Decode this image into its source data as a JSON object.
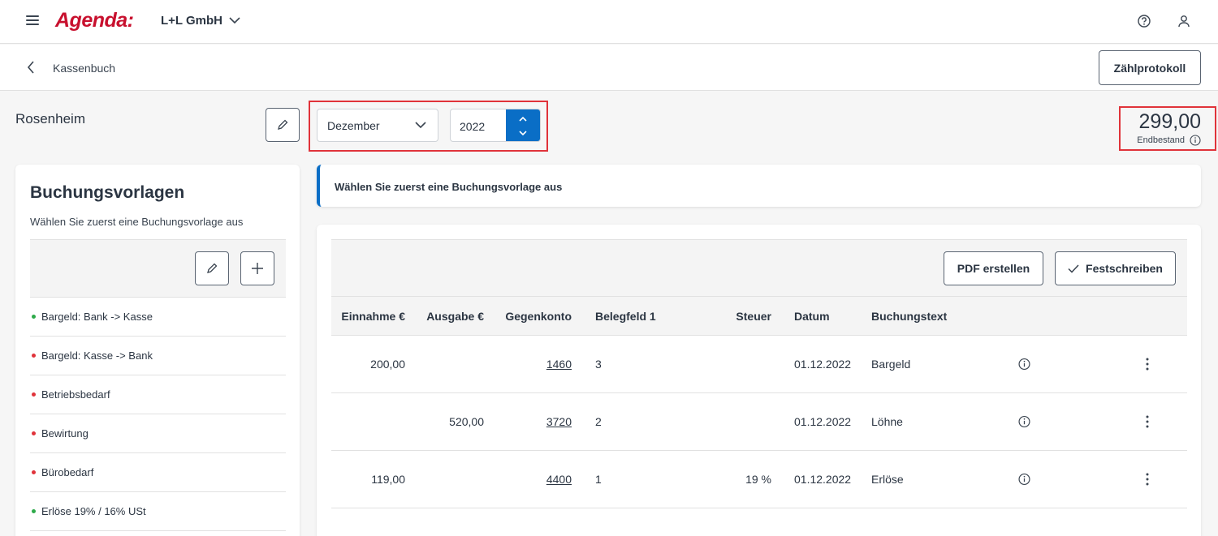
{
  "header": {
    "logo": "Agenda:",
    "company": "L+L GmbH"
  },
  "subheader": {
    "breadcrumb": "Kassenbuch",
    "count_protocol_label": "Zählprotokoll"
  },
  "location": {
    "name": "Rosenheim"
  },
  "period": {
    "month": "Dezember",
    "year": "2022"
  },
  "balance": {
    "amount": "299,00",
    "label": "Endbestand"
  },
  "templates": {
    "title": "Buchungsvorlagen",
    "subtitle": "Wählen Sie zuerst eine Buchungsvorlage aus",
    "items": [
      {
        "label": "Bargeld: Bank -> Kasse",
        "status": "green"
      },
      {
        "label": "Bargeld: Kasse -> Bank",
        "status": "red"
      },
      {
        "label": "Betriebsbedarf",
        "status": "red"
      },
      {
        "label": "Bewirtung",
        "status": "red"
      },
      {
        "label": "Bürobedarf",
        "status": "red"
      },
      {
        "label": "Erlöse 19% / 16% USt",
        "status": "green"
      }
    ]
  },
  "notice": {
    "text": "Wählen Sie zuerst eine Buchungsvorlage aus"
  },
  "table": {
    "pdf_label": "PDF erstellen",
    "lock_label": "Festschreiben",
    "columns": [
      "Einnahme €",
      "Ausgabe €",
      "Gegenkonto",
      "Belegfeld 1",
      "Steuer",
      "Datum",
      "Buchungstext"
    ],
    "rows": [
      {
        "einnahme": "200,00",
        "ausgabe": "",
        "gegenkonto": "1460",
        "beleg": "3",
        "steuer": "",
        "datum": "01.12.2022",
        "text": "Bargeld"
      },
      {
        "einnahme": "",
        "ausgabe": "520,00",
        "gegenkonto": "3720",
        "beleg": "2",
        "steuer": "",
        "datum": "01.12.2022",
        "text": "Löhne"
      },
      {
        "einnahme": "119,00",
        "ausgabe": "",
        "gegenkonto": "4400",
        "beleg": "1",
        "steuer": "19 %",
        "datum": "01.12.2022",
        "text": "Erlöse"
      }
    ]
  },
  "colors": {
    "brand": "#c8102e",
    "primary": "#0a6ec6",
    "highlight": "#e0333a",
    "status_green": "#2eaa4a",
    "status_red": "#e0333a"
  }
}
